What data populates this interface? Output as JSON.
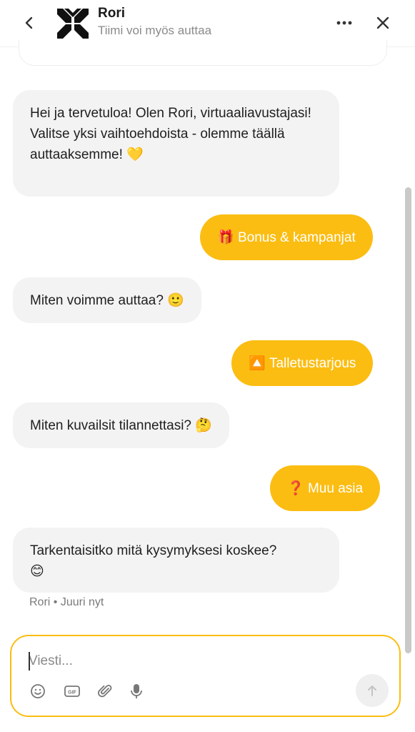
{
  "header": {
    "agent_name": "Rori",
    "agent_subtitle": "Tiimi voi myös auttaa",
    "icons": {
      "back": "chevron-left-icon",
      "more": "more-horizontal-icon",
      "close": "close-icon",
      "logo": "brand-logo"
    }
  },
  "messages": [
    {
      "from": "bot",
      "text": "Hei ja tervetuloa! Olen Rori, virtuaaliavustajasi! Valitse yksi vaihtoehdoista - olemme täällä auttaaksemme!",
      "emoji": "💛"
    },
    {
      "from": "user",
      "emoji": "🎁",
      "text": "Bonus & kampanjat"
    },
    {
      "from": "bot",
      "text": "Miten voimme auttaa?",
      "emoji": "🙂"
    },
    {
      "from": "user",
      "emoji": "🔼",
      "text": "Talletustarjous"
    },
    {
      "from": "bot",
      "text": "Miten kuvailsit tilannettasi?",
      "emoji": "🤔"
    },
    {
      "from": "user",
      "emoji": "❓",
      "text": "Muu asia"
    },
    {
      "from": "bot",
      "text": "Tarkentaisitko mitä kysymyksesi koskee?",
      "emoji": "😊"
    }
  ],
  "meta": {
    "sender": "Rori",
    "separator": "•",
    "time": "Juuri nyt"
  },
  "composer": {
    "placeholder": "Viesti...",
    "tools": [
      "emoji-icon",
      "gif-icon",
      "attachment-icon",
      "microphone-icon"
    ],
    "send_icon": "arrow-up-icon"
  },
  "colors": {
    "accent": "#fbbd12",
    "bot_bubble": "#f3f3f3",
    "muted_text": "#8a8a8a"
  }
}
